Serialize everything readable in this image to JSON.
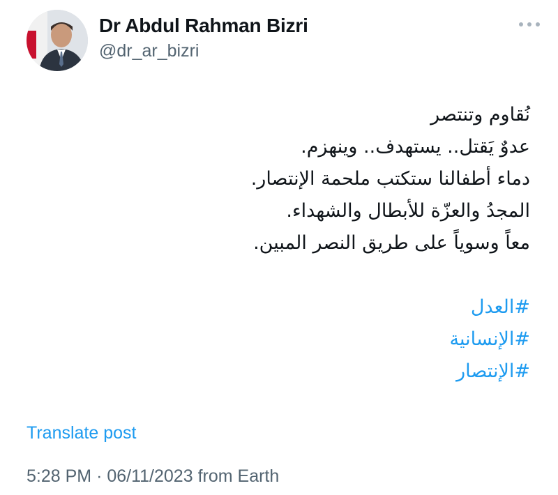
{
  "author": {
    "display_name": "Dr Abdul Rahman Bizri",
    "handle": "@dr_ar_bizri"
  },
  "more_menu": {
    "icon": "more-horizontal-icon"
  },
  "post": {
    "lines": [
      "نُقاوم وتنتصر",
      "عدوٌ يَقتل.. يستهدف.. وينهزم.",
      "دماء أطفالنا ستكتب ملحمة الإنتصار.",
      "المجدُ والعزّة للأبطال والشهداء.",
      "معاً وسوياً على طريق النصر المبين."
    ],
    "hashtags": [
      "#العدل",
      "#الإنسانية",
      "#الإنتصار"
    ]
  },
  "translate_label": "Translate post",
  "meta": {
    "time": "5:28 PM",
    "separator": "·",
    "date": "06/11/2023",
    "source": "from Earth"
  },
  "colors": {
    "text": "#0f1419",
    "secondary": "#536471",
    "link": "#1d9bf0"
  }
}
